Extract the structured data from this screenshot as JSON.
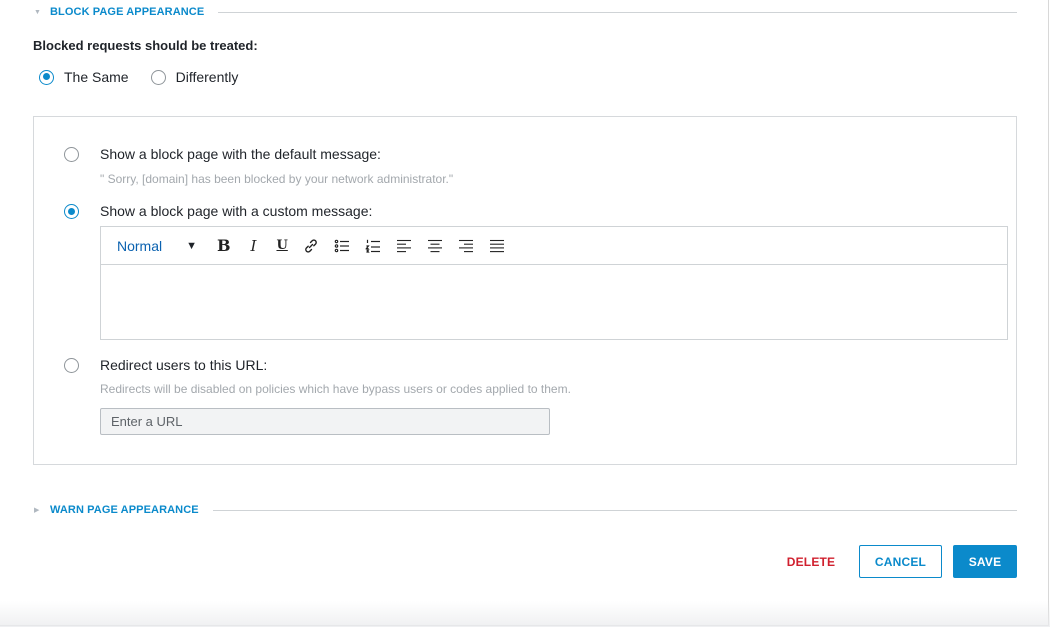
{
  "block_section": {
    "title": "BLOCK PAGE APPEARANCE",
    "question": "Blocked requests should be treated:",
    "treatment_options": [
      {
        "label": "The Same",
        "selected": true
      },
      {
        "label": "Differently",
        "selected": false
      }
    ],
    "default_option": {
      "label": "Show a block page with the default message:",
      "message": "\" Sorry, [domain] has been blocked by your network administrator.\"",
      "selected": false
    },
    "custom_option": {
      "label": "Show a block page with a custom message:",
      "selected": true
    },
    "editor": {
      "format_value": "Normal",
      "tools": [
        "bold",
        "italic",
        "underline",
        "link-icon",
        "bullet-list-icon",
        "numbered-list-icon",
        "align-left-icon",
        "align-center-icon",
        "align-right-icon",
        "align-justify-icon"
      ],
      "bold_glyph": "B",
      "italic_glyph": "I",
      "underline_glyph": "U",
      "content": ""
    },
    "redirect_option": {
      "label": "Redirect users to this URL:",
      "note": "Redirects will be disabled on policies which have bypass users or codes applied to them.",
      "url_placeholder": "Enter a URL",
      "url_value": "",
      "selected": false
    }
  },
  "warn_section": {
    "title": "WARN PAGE APPEARANCE"
  },
  "actions": {
    "delete_label": "DELETE",
    "cancel_label": "CANCEL",
    "save_label": "SAVE"
  },
  "colors": {
    "accent": "#0b8acb",
    "danger": "#d0202e",
    "muted_text": "#a3a8ad"
  }
}
